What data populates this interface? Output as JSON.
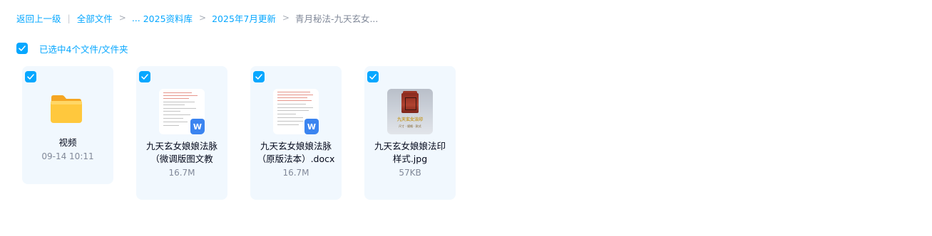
{
  "breadcrumb": {
    "back": "返回上一级",
    "all_files": "全部文件",
    "ellipsis": "...",
    "level1": "2025资料库",
    "level2": "2025年7月更新",
    "current": "青月秘法-九天玄女...",
    "separator": ">"
  },
  "selection": {
    "all_checked": true,
    "label": "已选中4个文件/文件夹"
  },
  "files": [
    {
      "name": "视频",
      "meta": "09-14 10:11",
      "type": "folder",
      "checked": true
    },
    {
      "name_line1": "九天玄女娘娘法脉",
      "name_line2": "（微调版图文教",
      "meta": "16.7M",
      "type": "docx",
      "badge": "W",
      "checked": true
    },
    {
      "name_line1": "九天玄女娘娘法脉",
      "name_line2": "（原版法本）.docx",
      "meta": "16.7M",
      "type": "docx",
      "badge": "W",
      "checked": true
    },
    {
      "name_line1": "九天玄女娘娘法印",
      "name_line2": "样式.jpg",
      "meta": "57KB",
      "type": "jpg",
      "thumb_caption": "九天玄女法印",
      "thumb_subcaption": "尺寸 · 规格 · 款式",
      "checked": true
    }
  ],
  "colors": {
    "accent": "#06a7ff",
    "card_bg": "#f1f8fe",
    "text_primary": "#03081a",
    "text_secondary": "#818999",
    "word_badge": "#3b84f0",
    "folder": "#ffc83d"
  },
  "icons": {
    "checkbox": "check-icon",
    "folder": "folder-icon",
    "word": "word-doc-icon",
    "image": "image-thumbnail"
  }
}
